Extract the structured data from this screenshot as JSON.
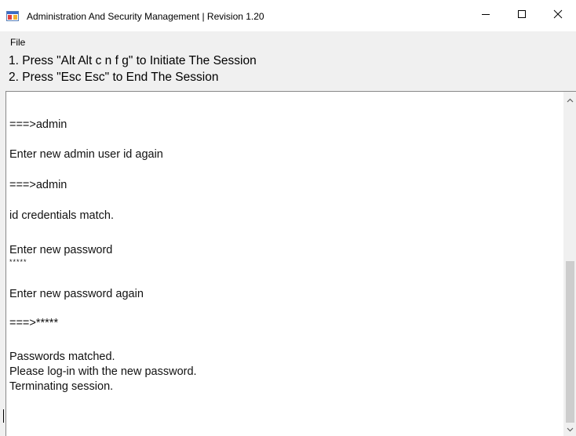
{
  "window": {
    "title": "Administration And Security Management | Revision 1.20",
    "controls": {
      "minimize_icon": "minimize-icon",
      "maximize_icon": "maximize-icon",
      "close_icon": "close-icon"
    }
  },
  "menubar": {
    "items": [
      {
        "label": "File"
      }
    ]
  },
  "instructions": [
    "1. Press \"Alt Alt c n f g\" to Initiate The Session",
    "2. Press \"Esc Esc\" to End The Session"
  ],
  "console": {
    "lines": [
      "===>admin",
      "Enter new admin user id again",
      "===>admin",
      "id credentials match.",
      "Enter new password",
      "*****",
      "Enter new password again",
      "===>*****",
      "Passwords matched.",
      "Please log-in with the new password.",
      "Terminating session."
    ]
  },
  "colors": {
    "titlebar": "#ffffff",
    "chrome": "#f0f0f0",
    "console_bg": "#ffffff",
    "scroll_thumb": "#cdcdcd"
  }
}
